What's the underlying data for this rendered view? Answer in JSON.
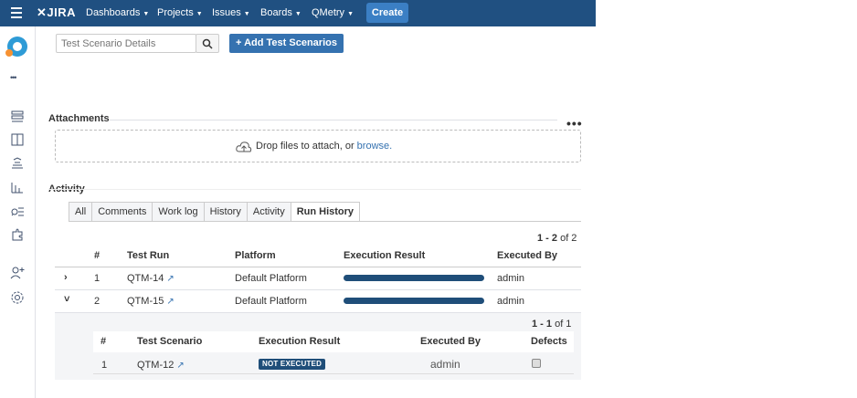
{
  "topbar": {
    "logo": "JIRA",
    "nav": [
      "Dashboards",
      "Projects",
      "Issues",
      "Boards",
      "QMetry"
    ],
    "create_label": "Create",
    "bg_color": "#205081"
  },
  "sidebar": {
    "more_label": "•••",
    "icons": [
      "project-avatar",
      "more-icon",
      "backlog-icon",
      "board-icon",
      "releases-icon",
      "reports-icon",
      "issues-search-icon",
      "addons-icon",
      "add-people-icon",
      "settings-icon"
    ]
  },
  "search": {
    "placeholder": "Test Scenario Details"
  },
  "add_button_label": "+ Add Test Scenarios",
  "attachments": {
    "title": "Attachments",
    "drop_text": "Drop files to attach, or ",
    "browse_link": "browse."
  },
  "activity": {
    "title": "Activity",
    "tabs": [
      "All",
      "Comments",
      "Work log",
      "History",
      "Activity",
      "Run History"
    ],
    "active_tab": "Run History"
  },
  "run_history": {
    "pager": {
      "range": "1 - 2",
      "of": "of 2"
    },
    "headers": [
      "#",
      "Test Run",
      "Platform",
      "Execution Result",
      "Executed By"
    ],
    "rows": [
      {
        "expander": "›",
        "num": "1",
        "run": "QTM-14",
        "platform": "Default Platform",
        "progress": 1.0,
        "executed_by": "admin"
      },
      {
        "expander": "˅",
        "num": "2",
        "run": "QTM-15",
        "platform": "Default Platform",
        "progress": 1.0,
        "executed_by": "admin"
      }
    ]
  },
  "scenario_subtable": {
    "pager": {
      "range": "1 - 1",
      "of": "of 1"
    },
    "headers": [
      "#",
      "Test Scenario",
      "Execution Result",
      "Executed By",
      "Defects"
    ],
    "rows": [
      {
        "num": "1",
        "scenario": "QTM-12",
        "result": "NOT EXECUTED",
        "executed_by": "admin"
      }
    ]
  }
}
